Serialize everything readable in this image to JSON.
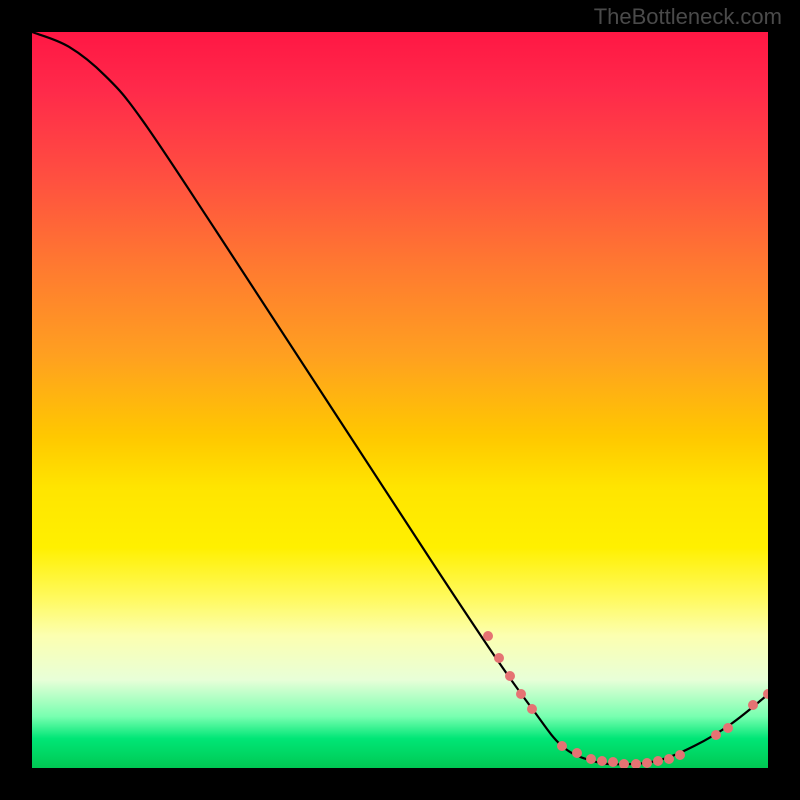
{
  "watermark": "TheBottleneck.com",
  "chart_data": {
    "type": "line",
    "title": "",
    "xlabel": "",
    "ylabel": "",
    "xlim": [
      0,
      100
    ],
    "ylim": [
      0,
      100
    ],
    "curve": [
      {
        "x": 0,
        "y": 100
      },
      {
        "x": 5,
        "y": 98
      },
      {
        "x": 10,
        "y": 94
      },
      {
        "x": 15,
        "y": 88
      },
      {
        "x": 25,
        "y": 73
      },
      {
        "x": 40,
        "y": 50
      },
      {
        "x": 55,
        "y": 27
      },
      {
        "x": 63,
        "y": 15
      },
      {
        "x": 68,
        "y": 8
      },
      {
        "x": 72,
        "y": 3
      },
      {
        "x": 76,
        "y": 1
      },
      {
        "x": 80,
        "y": 0.5
      },
      {
        "x": 85,
        "y": 1
      },
      {
        "x": 90,
        "y": 3
      },
      {
        "x": 95,
        "y": 6
      },
      {
        "x": 100,
        "y": 10
      }
    ],
    "dots": [
      {
        "x": 62,
        "y": 18
      },
      {
        "x": 63.5,
        "y": 15
      },
      {
        "x": 65,
        "y": 12.5
      },
      {
        "x": 66.5,
        "y": 10
      },
      {
        "x": 68,
        "y": 8
      },
      {
        "x": 72,
        "y": 3
      },
      {
        "x": 74,
        "y": 2
      },
      {
        "x": 76,
        "y": 1.2
      },
      {
        "x": 77.5,
        "y": 1
      },
      {
        "x": 79,
        "y": 0.8
      },
      {
        "x": 80.5,
        "y": 0.6
      },
      {
        "x": 82,
        "y": 0.6
      },
      {
        "x": 83.5,
        "y": 0.7
      },
      {
        "x": 85,
        "y": 0.9
      },
      {
        "x": 86.5,
        "y": 1.2
      },
      {
        "x": 88,
        "y": 1.8
      },
      {
        "x": 93,
        "y": 4.5
      },
      {
        "x": 94.5,
        "y": 5.5
      },
      {
        "x": 98,
        "y": 8.5
      },
      {
        "x": 100,
        "y": 10
      }
    ]
  }
}
